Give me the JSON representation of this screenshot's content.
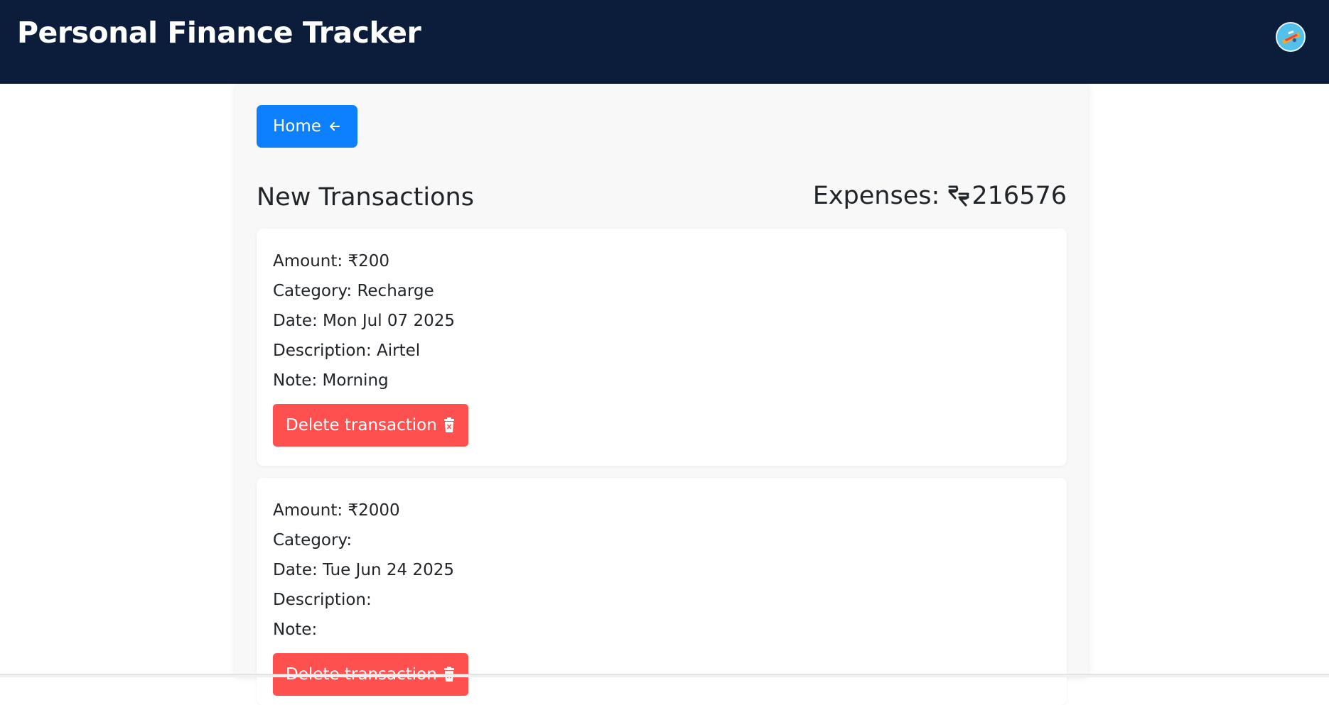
{
  "navbar": {
    "title": "Personal Finance Tracker",
    "avatar_icon": "user-avatar"
  },
  "home_button": {
    "label": "Home",
    "icon": "arrow-left-icon"
  },
  "page": {
    "title": "New Transactions",
    "expenses_label": "Expenses: ",
    "expenses_icon": "currency-exchange-icon",
    "expenses_value": "216576"
  },
  "transactions": [
    {
      "amount": "Amount: ₹200",
      "category": "Category: Recharge",
      "date": "Date: Mon Jul 07 2025",
      "description": "Description: Airtel",
      "note": "Note: Morning",
      "delete_label": "Delete transaction"
    },
    {
      "amount": "Amount: ₹2000",
      "category": "Category:",
      "date": "Date: Tue Jun 24 2025",
      "description": "Description:",
      "note": "Note:",
      "delete_label": "Delete transaction"
    }
  ],
  "colors": {
    "navbar": "#0c1d3b",
    "primary": "#0d80ff",
    "danger": "#ff5050",
    "panel": "#f8f8f8"
  }
}
